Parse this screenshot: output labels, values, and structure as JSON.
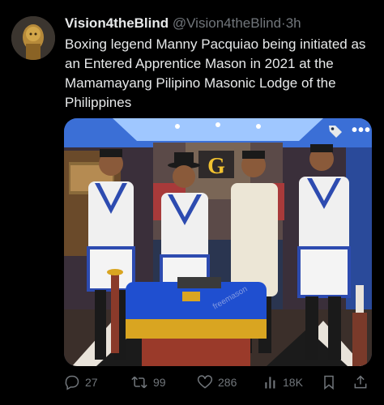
{
  "tweet": {
    "display_name": "Vision4theBlind",
    "handle": "@Vision4theBlind",
    "separator": "·",
    "time": "3h",
    "text": "Boxing legend Manny Pacquiao being initiated as an Entered Apprentice Mason in 2021 at the Mamamayang Pilipino Masonic Lodge of the Philippines",
    "media": {
      "sign_letter": "G",
      "watermark": "freemason",
      "more_label": "•••"
    },
    "actions": {
      "replies": "27",
      "retweets": "99",
      "likes": "286",
      "views": "18K"
    }
  },
  "colors": {
    "background": "#000000",
    "text": "#e7e9ea",
    "muted": "#71767b",
    "apron_blue": "#2d4bb0",
    "table_cover": "#1f4fd0",
    "gold": "#d9a521"
  },
  "icons": [
    "avatar",
    "tag-icon",
    "more-icon",
    "reply-icon",
    "retweet-icon",
    "like-icon",
    "views-icon",
    "bookmark-icon",
    "share-icon"
  ]
}
